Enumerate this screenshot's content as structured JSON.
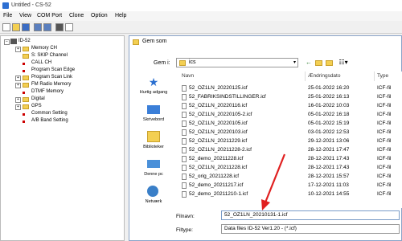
{
  "window": {
    "title": "Untitled - CS-52"
  },
  "menu": [
    "File",
    "View",
    "COM Port",
    "Clone",
    "Option",
    "Help"
  ],
  "toolbar_icons": [
    "new-file-icon",
    "open-folder-icon",
    "save-icon",
    "read-radio-icon",
    "write-radio-icon",
    "print-icon",
    "copy-icon"
  ],
  "tree": {
    "root": "ID-52",
    "items": [
      {
        "label": "Memory CH",
        "expandable": true,
        "icon": "folder"
      },
      {
        "label": "S: SKIP Channel",
        "expandable": false,
        "icon": "folder"
      },
      {
        "label": "CALL CH",
        "expandable": false,
        "icon": "leaf"
      },
      {
        "label": "Program Scan Edge",
        "expandable": false,
        "icon": "leaf"
      },
      {
        "label": "Program Scan Link",
        "expandable": true,
        "icon": "folder"
      },
      {
        "label": "FM Radio Memory",
        "expandable": true,
        "icon": "folder"
      },
      {
        "label": "DTMF Memory",
        "expandable": false,
        "icon": "leaf"
      },
      {
        "label": "Digital",
        "expandable": true,
        "icon": "folder"
      },
      {
        "label": "GPS",
        "expandable": true,
        "icon": "folder"
      },
      {
        "label": "Common Setting",
        "expandable": false,
        "icon": "leaf"
      },
      {
        "label": "A/B Band Setting",
        "expandable": false,
        "icon": "leaf"
      }
    ]
  },
  "dialog": {
    "title": "Gem som",
    "save_in_label": "Gem i:",
    "save_in_value": "ics",
    "places": [
      "Hurtig adgang",
      "Skrivebord",
      "Biblioteker",
      "Denne pc",
      "Netværk"
    ],
    "columns": {
      "name": "Navn",
      "date": "Ændringsdato",
      "type": "Type"
    },
    "files": [
      {
        "name": "52_OZ1LN_20220125.icf",
        "date": "25-01-2022 16:20",
        "type": "ICF-fil"
      },
      {
        "name": "52_FABRIKSINDSTILLINGER.icf",
        "date": "25-01-2022 16:13",
        "type": "ICF-fil"
      },
      {
        "name": "52_OZ1LN_20220116.icf",
        "date": "16-01-2022 10:03",
        "type": "ICF-fil"
      },
      {
        "name": "52_OZ1LN_20220105-2.icf",
        "date": "05-01-2022 16:18",
        "type": "ICF-fil"
      },
      {
        "name": "52_OZ1LN_20220105.icf",
        "date": "05-01-2022 15:19",
        "type": "ICF-fil"
      },
      {
        "name": "52_OZ1LN_20220103.icf",
        "date": "03-01-2022 12:53",
        "type": "ICF-fil"
      },
      {
        "name": "52_OZ1LN_20211229.icf",
        "date": "29-12-2021 13:06",
        "type": "ICF-fil"
      },
      {
        "name": "52_OZ1LN_20211228-2.icf",
        "date": "28-12-2021 17:47",
        "type": "ICF-fil"
      },
      {
        "name": "52_demo_20211228.icf",
        "date": "28-12-2021 17:43",
        "type": "ICF-fil"
      },
      {
        "name": "52_OZ1LN_20211228.icf",
        "date": "28-12-2021 17:43",
        "type": "ICF-fil"
      },
      {
        "name": "52_orig_20211228.icf",
        "date": "28-12-2021 15:57",
        "type": "ICF-fil"
      },
      {
        "name": "52_demo_20211217.icf",
        "date": "17-12-2021 11:03",
        "type": "ICF-fil"
      },
      {
        "name": "52_demo_20211210-1.icf",
        "date": "10-12-2021 14:55",
        "type": "ICF-fil"
      }
    ],
    "filename_label": "Filnavn:",
    "filename_value": "52_OZ1LN_20210131-1.icf",
    "filetype_label": "Filtype:",
    "filetype_value": "Data files ID-52 Ver1.20 - (*.icf)"
  },
  "colors": {
    "annotation_arrow": "#e02020",
    "folder": "#f3cf52",
    "accent": "#2d6fd2"
  }
}
